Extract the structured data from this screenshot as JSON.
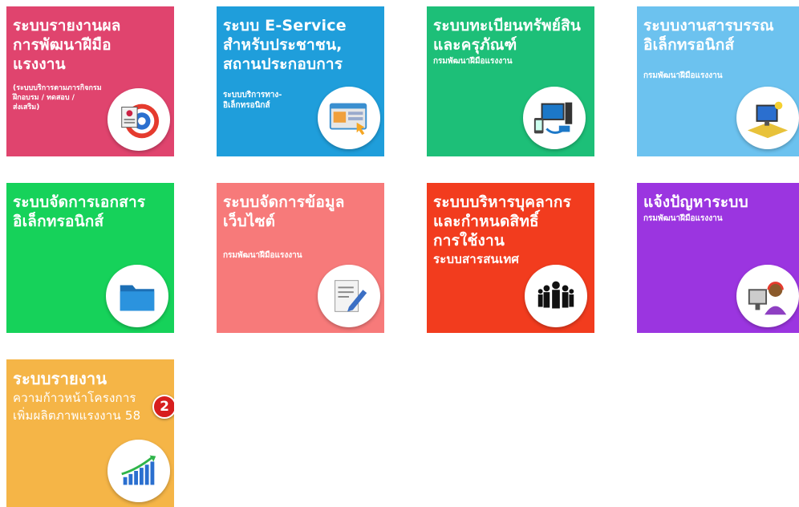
{
  "tiles": [
    {
      "title": [
        "ระบบรายงานผล",
        "การพัฒนาฝีมือ",
        "แรงงาน"
      ],
      "sub": [
        "(ระบบบริการตามภารกิจกรม",
        "ฝึกอบรม / ทดสอบ /",
        "ส่งเสริม)"
      ],
      "color": "#e0446e",
      "icon": "target-report-icon"
    },
    {
      "title": [
        "ระบบ E-Service",
        "สำหรับประชาชน,",
        "สถานประกอบการ"
      ],
      "sub": [
        "ระบบบริการทาง-",
        "อิเล็กทรอนิกส์"
      ],
      "color": "#1f9edb",
      "icon": "web-service-icon"
    },
    {
      "title": [
        "ระบบทะเบียนทรัพย์สิน",
        "และครุภัณฑ์"
      ],
      "sub": [
        "กรมพัฒนาฝีมือแรงงาน"
      ],
      "color": "#1dbf78",
      "icon": "devices-icon"
    },
    {
      "title": [
        "ระบบงานสารบรรณ",
        "อิเล็กทรอนิกส์"
      ],
      "sub": [
        "กรมพัฒนาฝีมือแรงงาน"
      ],
      "color": "#6cc2ef",
      "icon": "computer-desk-icon"
    },
    {
      "title": [
        "ระบบจัดการเอกสาร",
        "อิเล็กทรอนิกส์"
      ],
      "sub": [],
      "color": "#16d25a",
      "icon": "folder-icon"
    },
    {
      "title": [
        "ระบบจัดการข้อมูล",
        "เว็บไซต์"
      ],
      "sub": [
        "กรมพัฒนาฝีมือแรงงาน"
      ],
      "color": "#f77a7a",
      "icon": "edit-document-icon"
    },
    {
      "title": [
        "ระบบบริหารบุคลากร",
        "และกำหนดสิทธิ์",
        "การใช้งาน",
        "ระบบสารสนเทศ"
      ],
      "sub": [],
      "color": "#f23c1e",
      "icon": "people-group-icon"
    },
    {
      "title": [
        "แจ้งปัญหาระบบ"
      ],
      "sub": [
        "กรมพัฒนาฝีมือแรงงาน"
      ],
      "color": "#9b35e0",
      "icon": "support-agent-icon"
    },
    {
      "title": [
        "ระบบรายงาน",
        "ความก้าวหน้าโครงการ",
        "เพิ่มผลิตภาพแรงงาน 58"
      ],
      "sub": [],
      "color": "#f5b547",
      "icon": "growth-chart-icon",
      "badge": "2"
    }
  ]
}
